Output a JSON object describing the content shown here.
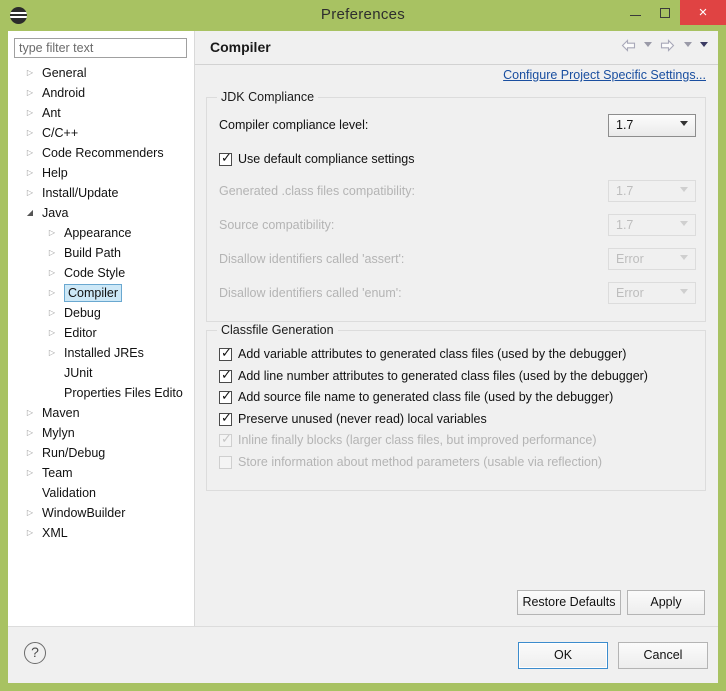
{
  "window": {
    "title": "Preferences",
    "app_icon": "eclipse-icon",
    "controls": {
      "minimize": "minimize-icon",
      "maximize": "maximize-icon",
      "close": "close-icon",
      "close_glyph": "×"
    },
    "titlebar_color": "#a8c262",
    "close_color": "#e04343"
  },
  "sidebar": {
    "filter": {
      "placeholder": "type filter text",
      "value": ""
    },
    "tree": [
      {
        "label": "General",
        "depth": 0,
        "arrow": "collapsed",
        "selected": false
      },
      {
        "label": "Android",
        "depth": 0,
        "arrow": "collapsed",
        "selected": false
      },
      {
        "label": "Ant",
        "depth": 0,
        "arrow": "collapsed",
        "selected": false
      },
      {
        "label": "C/C++",
        "depth": 0,
        "arrow": "collapsed",
        "selected": false
      },
      {
        "label": "Code Recommenders",
        "depth": 0,
        "arrow": "collapsed",
        "selected": false
      },
      {
        "label": "Help",
        "depth": 0,
        "arrow": "collapsed",
        "selected": false
      },
      {
        "label": "Install/Update",
        "depth": 0,
        "arrow": "collapsed",
        "selected": false
      },
      {
        "label": "Java",
        "depth": 0,
        "arrow": "expanded",
        "selected": false
      },
      {
        "label": "Appearance",
        "depth": 1,
        "arrow": "collapsed",
        "selected": false
      },
      {
        "label": "Build Path",
        "depth": 1,
        "arrow": "collapsed",
        "selected": false
      },
      {
        "label": "Code Style",
        "depth": 1,
        "arrow": "collapsed",
        "selected": false
      },
      {
        "label": "Compiler",
        "depth": 1,
        "arrow": "collapsed",
        "selected": true
      },
      {
        "label": "Debug",
        "depth": 1,
        "arrow": "collapsed",
        "selected": false
      },
      {
        "label": "Editor",
        "depth": 1,
        "arrow": "collapsed",
        "selected": false
      },
      {
        "label": "Installed JREs",
        "depth": 1,
        "arrow": "collapsed",
        "selected": false
      },
      {
        "label": "JUnit",
        "depth": 1,
        "arrow": "none",
        "selected": false
      },
      {
        "label": "Properties Files Edito",
        "depth": 1,
        "arrow": "none",
        "selected": false
      },
      {
        "label": "Maven",
        "depth": 0,
        "arrow": "collapsed",
        "selected": false
      },
      {
        "label": "Mylyn",
        "depth": 0,
        "arrow": "collapsed",
        "selected": false
      },
      {
        "label": "Run/Debug",
        "depth": 0,
        "arrow": "collapsed",
        "selected": false
      },
      {
        "label": "Team",
        "depth": 0,
        "arrow": "collapsed",
        "selected": false
      },
      {
        "label": "Validation",
        "depth": 0,
        "arrow": "none",
        "selected": false
      },
      {
        "label": "WindowBuilder",
        "depth": 0,
        "arrow": "collapsed",
        "selected": false
      },
      {
        "label": "XML",
        "depth": 0,
        "arrow": "collapsed",
        "selected": false
      }
    ],
    "scrollbar": {
      "left_arrow": "‹",
      "right_arrow": "›"
    }
  },
  "page": {
    "title": "Compiler",
    "nav": {
      "back_icon": "back-arrow-icon",
      "back_menu_icon": "chevron-down-icon",
      "forward_icon": "forward-arrow-icon",
      "forward_menu_icon": "chevron-down-icon",
      "menu_icon": "chevron-down-icon"
    },
    "project_settings_link": "Configure Project Specific Settings...",
    "link_color": "#1a4fa0"
  },
  "jdk_compliance": {
    "title": "JDK Compliance",
    "compliance_level": {
      "label": "Compiler compliance level:",
      "value": "1.7",
      "disabled": false
    },
    "use_default": {
      "label": "Use default compliance settings",
      "checked": true,
      "disabled": false
    },
    "rows": [
      {
        "label": "Generated .class files compatibility:",
        "value": "1.7",
        "disabled": true
      },
      {
        "label": "Source compatibility:",
        "value": "1.7",
        "disabled": true
      },
      {
        "label": "Disallow identifiers called 'assert':",
        "value": "Error",
        "disabled": true
      },
      {
        "label": "Disallow identifiers called 'enum':",
        "value": "Error",
        "disabled": true
      }
    ]
  },
  "classfile_generation": {
    "title": "Classfile Generation",
    "options": [
      {
        "label": "Add variable attributes to generated class files (used by the debugger)",
        "checked": true,
        "disabled": false
      },
      {
        "label": "Add line number attributes to generated class files (used by the debugger)",
        "checked": true,
        "disabled": false
      },
      {
        "label": "Add source file name to generated class file (used by the debugger)",
        "checked": true,
        "disabled": false
      },
      {
        "label": "Preserve unused (never read) local variables",
        "checked": true,
        "disabled": false
      },
      {
        "label": "Inline finally blocks (larger class files, but improved performance)",
        "checked": true,
        "disabled": true
      },
      {
        "label": "Store information about method parameters (usable via reflection)",
        "checked": false,
        "disabled": true
      }
    ]
  },
  "actions": {
    "restore_defaults": "Restore Defaults",
    "apply": "Apply",
    "ok": "OK",
    "cancel": "Cancel",
    "help_icon": "help-icon",
    "help_glyph": "?"
  }
}
